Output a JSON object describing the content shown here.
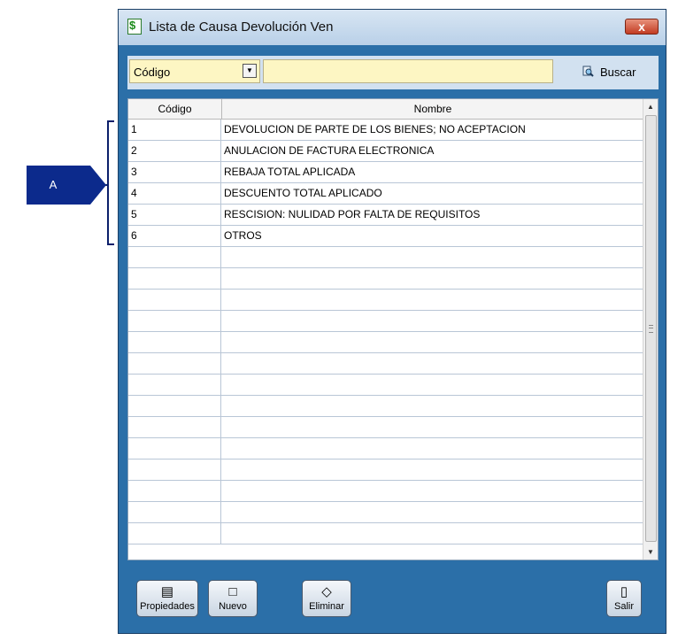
{
  "callout": {
    "label": "A"
  },
  "window": {
    "title": "Lista de Causa Devolución Ven",
    "close_label": "x"
  },
  "toolbar": {
    "field_select": "Código",
    "search_value": "",
    "search_label": "Buscar"
  },
  "grid": {
    "columns": [
      "Código",
      "Nombre"
    ],
    "rows": [
      {
        "code": "1",
        "name": "DEVOLUCION DE PARTE DE LOS BIENES; NO ACEPTACION"
      },
      {
        "code": "2",
        "name": "ANULACION DE FACTURA ELECTRONICA"
      },
      {
        "code": "3",
        "name": "REBAJA TOTAL APLICADA"
      },
      {
        "code": "4",
        "name": "DESCUENTO TOTAL APLICADO"
      },
      {
        "code": "5",
        "name": "RESCISION: NULIDAD POR FALTA DE REQUISITOS"
      },
      {
        "code": "6",
        "name": "OTROS"
      },
      {
        "code": "",
        "name": ""
      },
      {
        "code": "",
        "name": ""
      },
      {
        "code": "",
        "name": ""
      },
      {
        "code": "",
        "name": ""
      },
      {
        "code": "",
        "name": ""
      },
      {
        "code": "",
        "name": ""
      },
      {
        "code": "",
        "name": ""
      },
      {
        "code": "",
        "name": ""
      },
      {
        "code": "",
        "name": ""
      },
      {
        "code": "",
        "name": ""
      },
      {
        "code": "",
        "name": ""
      },
      {
        "code": "",
        "name": ""
      },
      {
        "code": "",
        "name": ""
      },
      {
        "code": "",
        "name": ""
      }
    ]
  },
  "buttons": {
    "properties": "Propiedades",
    "new": "Nuevo",
    "delete": "Eliminar",
    "exit": "Salir"
  },
  "colors": {
    "window_bg": "#2b6fa8",
    "input_bg": "#fdf6c3",
    "callout": "#0c2a8c"
  }
}
